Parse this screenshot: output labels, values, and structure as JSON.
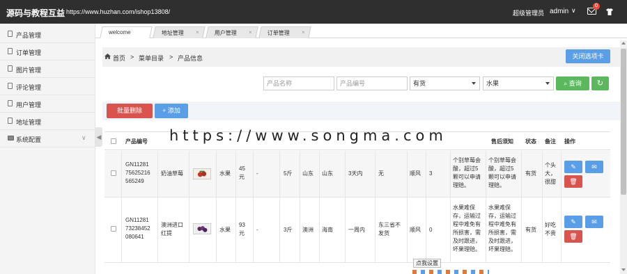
{
  "topbar": {
    "logo": "源码与教程互益",
    "url": "https://www.huzhan.com/ishop13808/",
    "role": "超级管理员",
    "username": "admin",
    "caret": "∨",
    "mail_badge": "0"
  },
  "sidebar": {
    "items": [
      {
        "label": "产品管理"
      },
      {
        "label": "订单管理"
      },
      {
        "label": "图片管理"
      },
      {
        "label": "评论管理"
      },
      {
        "label": "用户管理"
      },
      {
        "label": "地址管理"
      },
      {
        "label": "系统配置"
      }
    ],
    "collapse_glyph": "◀"
  },
  "tabs": [
    {
      "label": "welcome"
    },
    {
      "label": "地址管理",
      "close": "×"
    },
    {
      "label": "用户管理",
      "close": "×"
    },
    {
      "label": "订单管理",
      "close": "×"
    }
  ],
  "breadcrumb": {
    "home": "首页",
    "sep1": ">",
    "menu": "菜单目录",
    "sep2": ">",
    "current": "产品信息",
    "close_tabs_button": "关闭选项卡"
  },
  "filters": {
    "name_placeholder": "产品名称",
    "code_placeholder": "产品编号",
    "stock_value": "有货",
    "type_value": "水果",
    "search_button": "查询",
    "refresh_glyph": "↻"
  },
  "actions": {
    "batch_delete": "批量删除",
    "add": "+ 添加"
  },
  "watermark": "https://www.songma.com",
  "table": {
    "headers": {
      "code": "产品编号",
      "after_sale": "售后须知",
      "status": "状态",
      "remark": "备注",
      "ops": "操作"
    },
    "rows": [
      {
        "code": [
          "GN11281",
          "75625216",
          "565249"
        ],
        "name": [
          "奶油草莓"
        ],
        "type": "水果",
        "price": [
          "45",
          "元"
        ],
        "dash": "-",
        "weight": "5斤",
        "origin1": "山东",
        "origin2": "山东",
        "ship": "3天内",
        "extra": "无",
        "express": "顺风",
        "count": "3",
        "note1": [
          "个别草莓会",
          "酸，超过5",
          "颗可以申请",
          "理赔。"
        ],
        "note2": [
          "个别草莓会",
          "酸，超过5",
          "颗可以申请",
          "理赔。"
        ],
        "status": "有货",
        "remark": [
          "个头",
          "大，",
          "很甜"
        ]
      },
      {
        "code": [
          "GN11281",
          "73238452",
          "080641"
        ],
        "name": [
          "澳洲进口",
          "红提"
        ],
        "type": "水果",
        "price": [
          "93",
          "元"
        ],
        "dash": "-",
        "weight": "3斤",
        "origin1": "澳洲",
        "origin2": "海南",
        "ship": "一周内",
        "extra": [
          "东三省不",
          "发货"
        ],
        "express": "顺风",
        "count": "0",
        "note1": [
          "水果难保",
          "存，运输过",
          "程中难免有",
          "所损害，需",
          "及时跟进，",
          "坏果理赔。"
        ],
        "note2": [
          "水果难保",
          "存，运输过",
          "程中难免有",
          "所损害，需",
          "及时跟进，",
          "坏果理赔。"
        ],
        "status": "有货",
        "remark": [
          "好吃",
          "不贵"
        ]
      }
    ],
    "edit_glyph": "✎",
    "view_glyph": "✉",
    "delete_glyph": "🗑"
  },
  "tooltip": "点我设置",
  "colors": {
    "topbar": "#2f2f2f",
    "primary": "#5a9ee8",
    "danger": "#d9534f",
    "success": "#5cb85c"
  }
}
